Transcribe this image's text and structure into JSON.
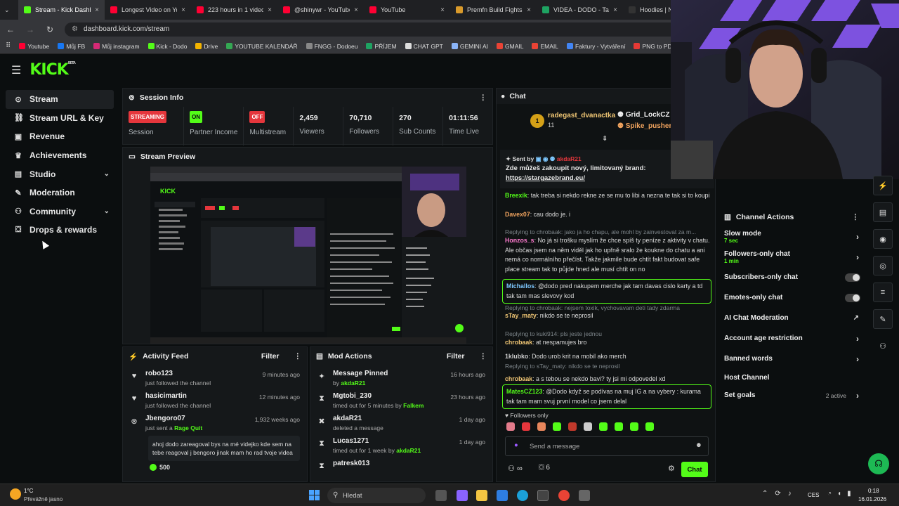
{
  "browser": {
    "tabs": [
      {
        "title": "Stream - Kick Dashb",
        "color": "#53fc18",
        "active": true
      },
      {
        "title": "Longest Video on Yo",
        "color": "#ff0033"
      },
      {
        "title": "223 hours in 1 video",
        "color": "#ff0033"
      },
      {
        "title": "@shinywr - YouTube",
        "color": "#ff0033"
      },
      {
        "title": "YouTube",
        "color": "#ff0033"
      },
      {
        "title": "Premfn Build Fights",
        "color": "#d99a2b"
      },
      {
        "title": "VIDEA - DODO - Tab",
        "color": "#1ea362"
      },
      {
        "title": "Hoodies | Nu",
        "color": "#333"
      }
    ],
    "url": "dashboard.kick.com/stream",
    "bookmarks": [
      {
        "label": "Youtube",
        "color": "#ff0033"
      },
      {
        "label": "Můj FB",
        "color": "#1877f2"
      },
      {
        "label": "Můj instagram",
        "color": "#d62976"
      },
      {
        "label": "Kick - Dodo",
        "color": "#53fc18"
      },
      {
        "label": "Drive",
        "color": "#f4b400"
      },
      {
        "label": "YOUTUBE KALENDÁŘ",
        "color": "#34a853"
      },
      {
        "label": "FNGG - Dodoeu",
        "color": "#888"
      },
      {
        "label": "PŘÍJEM",
        "color": "#1ea362"
      },
      {
        "label": "CHAT GPT",
        "color": "#ddd"
      },
      {
        "label": "GEMINI AI",
        "color": "#8ab4f8"
      },
      {
        "label": "GMAIL",
        "color": "#ea4335"
      },
      {
        "label": "EMAIL",
        "color": "#ea4335"
      },
      {
        "label": "Faktury - Vytváření",
        "color": "#4285f4"
      },
      {
        "label": "PNG to PDI",
        "color": "#e53935"
      }
    ]
  },
  "sidebar": {
    "items": [
      {
        "label": "Stream",
        "icon": "broadcast-icon",
        "glyph": "⊙"
      },
      {
        "label": "Stream URL & Key",
        "icon": "link-icon",
        "glyph": "⛓"
      },
      {
        "label": "Revenue",
        "icon": "money-icon",
        "glyph": "▣"
      },
      {
        "label": "Achievements",
        "icon": "trophy-icon",
        "glyph": "♛"
      },
      {
        "label": "Studio",
        "icon": "studio-icon",
        "glyph": "▤"
      },
      {
        "label": "Moderation",
        "icon": "wrench-icon",
        "glyph": "✎"
      },
      {
        "label": "Community",
        "icon": "people-icon",
        "glyph": "⚇"
      },
      {
        "label": "Drops & rewards",
        "icon": "gift-icon",
        "glyph": "⛋"
      }
    ]
  },
  "session": {
    "title": "Session Info",
    "stats": [
      {
        "badge": "STREAMING",
        "badge_color": "#e5363c",
        "label": "Session"
      },
      {
        "badge": "ON",
        "badge_color": "#53fc18",
        "label": "Partner Income"
      },
      {
        "badge": "OFF",
        "badge_color": "#e5363c",
        "label": "Multistream"
      },
      {
        "value": "2,459",
        "label": "Viewers"
      },
      {
        "value": "70,710",
        "label": "Followers"
      },
      {
        "value": "270",
        "label": "Sub Counts"
      },
      {
        "value": "01:11:56",
        "label": "Time Live"
      }
    ]
  },
  "preview": {
    "title": "Stream Preview"
  },
  "activity": {
    "title": "Activity Feed",
    "filter": "Filter",
    "items": [
      {
        "name": "robo123",
        "sub": "just followed the channel",
        "time": "9 minutes ago",
        "icon": "heart-icon"
      },
      {
        "name": "hasicimartin",
        "sub": "just followed the channel",
        "time": "12 minutes ago",
        "icon": "heart-icon"
      },
      {
        "name": "Jbengoro07",
        "sub_prefix": "just sent a ",
        "sub_strong": "Rage Quit",
        "time": "1,932 weeks ago",
        "icon": "kick-icon",
        "quote": "ahoj dodo zareagoval bys na mé videjko kde sem na tebe reagoval j bengoro jinak mam ho rad tvoje videa",
        "kicks": "500"
      }
    ]
  },
  "mod": {
    "title": "Mod Actions",
    "filter": "Filter",
    "items": [
      {
        "name": "Message Pinned",
        "prefix": "by ",
        "strong": "akdaR21",
        "time": "16 hours ago",
        "icon": "pin-icon",
        "glyph": "✦"
      },
      {
        "name": "Mgtobi_230",
        "prefix": "timed out for 5 minutes by ",
        "strong": "Falkem",
        "time": "23 hours ago",
        "icon": "hourglass-icon",
        "glyph": "⧗"
      },
      {
        "name": "akdaR21",
        "prefix": "deleted a message",
        "strong": "",
        "time": "1 day ago",
        "icon": "trash-icon",
        "glyph": "✖"
      },
      {
        "name": "Lucas1271",
        "prefix": "timed out for 1 week by ",
        "strong": "akdaR21",
        "time": "1 day ago",
        "icon": "hourglass-icon",
        "glyph": "⧗"
      },
      {
        "name": "patresk013",
        "prefix": "",
        "strong": "",
        "time": "",
        "icon": "hourglass-icon",
        "glyph": "⧗"
      }
    ]
  },
  "chat": {
    "title": "Chat",
    "gift_count": "1",
    "gifter": "radegast_dvanactka",
    "gifter_sub": "11",
    "gifts": [
      "Grid_LockCZ",
      "Spike_pusher"
    ],
    "pinned_by": "Sent by",
    "pinned_user": "akdaR21",
    "pinned_text": "Zde můžeš zakoupit nový, limitovaný brand:",
    "pinned_link": "https://stargazebrand.eu/",
    "messages": [
      {
        "user": "Breexik",
        "color": "#53fc18",
        "text": "tak treba si nekdo rekne ze se mu to libi a nezna te tak si to koupi"
      },
      {
        "user": "Davex07",
        "color": "#f0a35e",
        "text": "cau dodo je. i"
      },
      {
        "reply": "Replying to chrobaak: jako ja ho chapu, ale mohl by zainvestovat za m..."
      },
      {
        "user": "Honzos_s",
        "color": "#ff7bd0",
        "text": "No já si trošku myslím že chce spíš ty peníze z aktivity v chatu. Ale občas jsem na něm viděl jak ho upřně sralo že koukne do chatu a ani nemá co normálního přečíst. Takže jakmile bude chtít fakt budovat safe place stream tak to půjde hned ale musí chtít on no"
      },
      {
        "user": "Michallos",
        "color": "#7ec8ff",
        "text": "@dodo pred nakupem merche jak tam davas cislo karty a td tak tam mas slevovy kod",
        "highlight": true
      },
      {
        "reply": "Replying to chrobaak: nejsem toxik, vychovavam deti tady zdarma"
      },
      {
        "user": "sTay_maty",
        "color": "#f0c674",
        "text": "nikdo se te neprosil"
      },
      {
        "reply": "Replying to kuki914: pls jeste jednou"
      },
      {
        "user": "chrobaak",
        "color": "#f0c674",
        "text": "at nespamujes bro"
      },
      {
        "user": "1klubko",
        "color": "#cccccc",
        "text": "Dodo urob krit na mobil ako merch"
      },
      {
        "reply": "Replying to sTay_maty: nikdo se te neprosil"
      },
      {
        "user": "chrobaak",
        "color": "#f0c674",
        "text": "a s tebou se nekdo bavi? ty jsi mi odpovedel xd"
      },
      {
        "user": "MatesCZ123",
        "color": "#53fc18",
        "text": "@Dodo když se podívas na muj IG a na vybery : kurama tak tam mam svuj první model co jsem delal",
        "highlight": true
      }
    ],
    "mode": "Followers only",
    "placeholder": "Send a message",
    "viewers_icon": "∞",
    "count": "6",
    "send": "Chat"
  },
  "channel_actions": {
    "title": "Channel Actions",
    "items": [
      {
        "label": "Slow mode",
        "sub": "7 sec",
        "type": "arrow"
      },
      {
        "label": "Followers-only chat",
        "sub": "1 min",
        "type": "arrow"
      },
      {
        "label": "Subscribers-only chat",
        "type": "toggle"
      },
      {
        "label": "Emotes-only chat",
        "type": "toggle"
      },
      {
        "label": "AI Chat Moderation",
        "type": "external"
      },
      {
        "label": "Account age restriction",
        "type": "arrow"
      },
      {
        "label": "Banned words",
        "type": "arrow"
      },
      {
        "label": "Host Channel",
        "type": "none"
      },
      {
        "label": "Set goals",
        "sub_right": "2 active",
        "type": "arrow"
      }
    ]
  },
  "taskbar": {
    "temp": "1°C",
    "weather": "Převážně jasno",
    "search": "Hledat",
    "lang": "CES",
    "time": "0:18",
    "date": "16.01.2026"
  }
}
